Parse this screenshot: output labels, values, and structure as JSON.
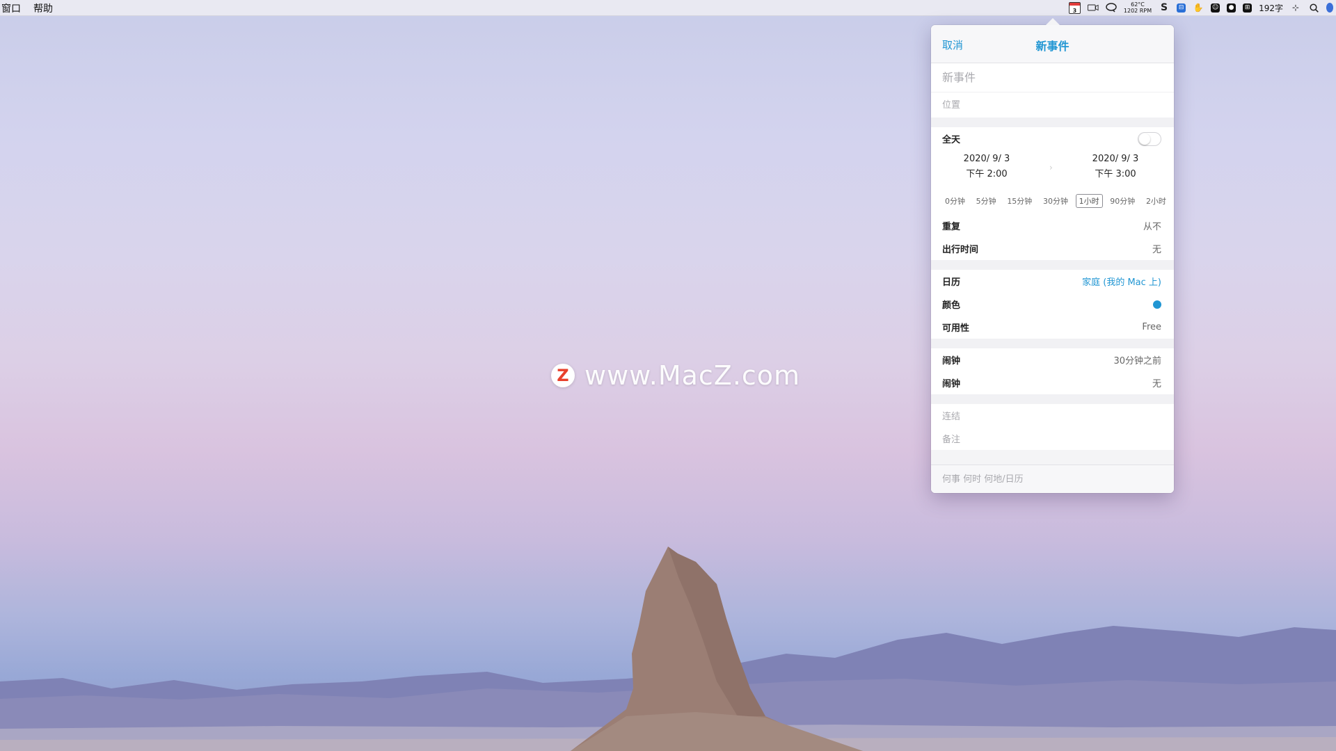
{
  "menubar": {
    "left_items": [
      "窗口",
      "帮助"
    ],
    "calendar_day": "3",
    "temp": "62°C",
    "fan": "1202 RPM",
    "word_count": "192字"
  },
  "watermark": {
    "logo_letter": "Z",
    "text": "www.MacZ.com"
  },
  "popover": {
    "cancel_label": "取消",
    "title": "新事件",
    "title_placeholder": "新事件",
    "location_placeholder": "位置",
    "all_day_label": "全天",
    "start": {
      "date": "2020/  9/  3",
      "time": "下午  2:00"
    },
    "end": {
      "date": "2020/  9/  3",
      "time": "下午  3:00"
    },
    "durations": [
      "0分钟",
      "5分钟",
      "15分钟",
      "30分钟",
      "1小时",
      "90分钟",
      "2小时"
    ],
    "selected_duration": "1小时",
    "repeat": {
      "label": "重复",
      "value": "从不"
    },
    "travel": {
      "label": "出行时间",
      "value": "无"
    },
    "calendar": {
      "label": "日历",
      "value": "家庭 (我的 Mac 上)"
    },
    "color": {
      "label": "颜色",
      "value": "#2196d3"
    },
    "availability": {
      "label": "可用性",
      "value": "Free"
    },
    "alarm1": {
      "label": "闹钟",
      "value": "30分钟之前"
    },
    "alarm2": {
      "label": "闹钟",
      "value": "无"
    },
    "link_placeholder": "连结",
    "notes_placeholder": "备注",
    "quick_placeholder": "何事 何时 何地/日历"
  },
  "colors": {
    "accent": "#2196d3"
  }
}
